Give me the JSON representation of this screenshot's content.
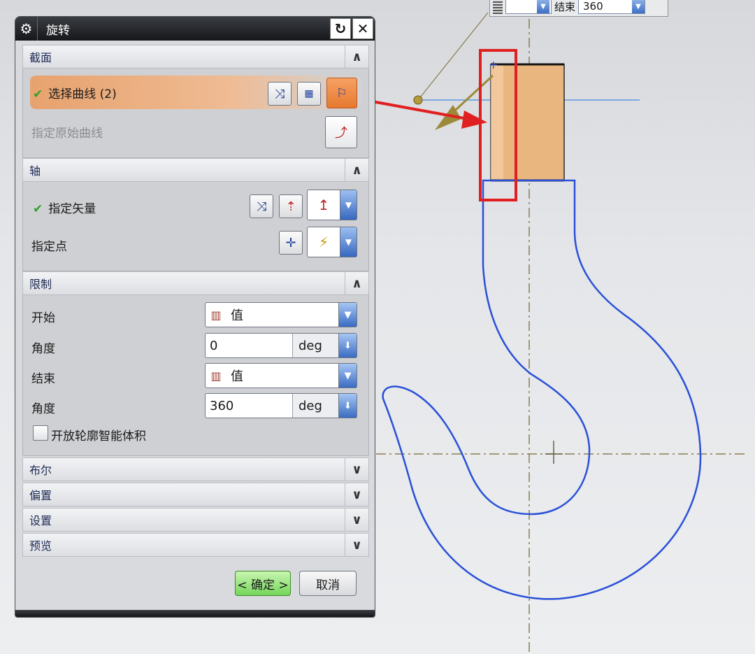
{
  "dialog": {
    "title": "旋转",
    "reset_icon": "↻",
    "close_icon": "✕"
  },
  "section_profile": {
    "title": "截面",
    "select_curve": "选择曲线 (2)",
    "specify_original_curve": "指定原始曲线"
  },
  "section_axis": {
    "title": "轴",
    "specify_vector": "指定矢量",
    "specify_point": "指定点"
  },
  "section_limits": {
    "title": "限制",
    "start_label": "开始",
    "start_option": "值",
    "start_angle_label": "角度",
    "start_angle_value": "0",
    "start_unit": "deg",
    "end_label": "结束",
    "end_option": "值",
    "end_angle_label": "角度",
    "end_angle_value": "360",
    "end_unit": "deg",
    "open_profile_label": "开放轮廓智能体积"
  },
  "collapsed_sections": {
    "boolean": "布尔",
    "offset": "偏置",
    "settings": "设置",
    "preview": "预览"
  },
  "buttons": {
    "ok": "< 确定 >",
    "cancel": "取消"
  },
  "mini_toolbar": {
    "end_label": "结束",
    "end_value": "360"
  },
  "colors": {
    "hook_curve": "#2a50d8",
    "highlight_box": "#e02020",
    "solid_fill": "#e9b67f",
    "active_button": "#e6792e"
  }
}
